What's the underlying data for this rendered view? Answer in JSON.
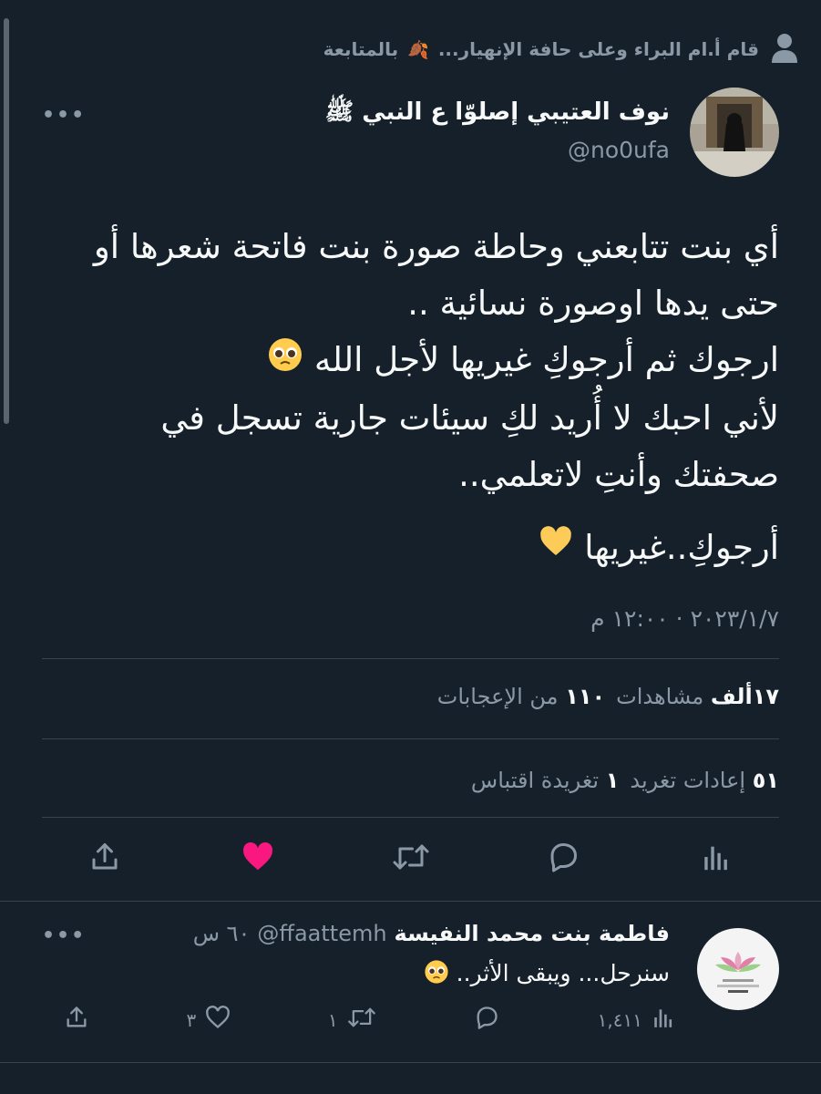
{
  "social_context": {
    "text": "قام أ.ام البراء وعلى حافة الإنهيار...",
    "text_suffix": "بالمتابعة"
  },
  "tweet": {
    "display_name": "نوف العتيبي إصلوّا ع النبي ﷺ",
    "handle": "@no0ufa",
    "lines": [
      "أي بنت  تتابعني وحاطة صورة بنت فاتحة شعرها أو",
      "حتى يدها اوصورة نسائية ..",
      "ارجوك ثم أرجوكِ غيريها لأجل الله",
      "لأني احبك لا أُريد لكِ سيئات جارية تسجل في",
      "صحفتك وأنتِ لاتعلمي..",
      "أرجوكِ..غيريها"
    ],
    "timestamp": "٢٠٢٣/١/٧ · ١٢:٠٠ م"
  },
  "stats": {
    "views_count": "١٧ألف",
    "views_label": "مشاهدات",
    "likes_count": "١١٠",
    "likes_label": "من الإعجابات",
    "retweets_count": "٥١",
    "retweets_label": "إعادات تغريد",
    "quotes_count": "١",
    "quotes_label": "تغريدة اقتباس"
  },
  "colors": {
    "background": "#15202b",
    "text": "#f7f9f9",
    "muted": "#8b98a5",
    "like": "#f91880",
    "divider": "#38444d"
  },
  "icons": [
    "person-icon",
    "leaf-icon",
    "more-icon",
    "share-icon",
    "heart-icon",
    "retweet-icon",
    "reply-icon",
    "analytics-icon"
  ],
  "reply": {
    "display_name": "فاطمة بنت محمد النفيسة",
    "handle": "@ffaattemh",
    "time": "٦٠ س",
    "text": "سنرحل... ويبقى الأثر..",
    "views": "١,٤١١",
    "retweets": "١",
    "likes": "٣"
  }
}
